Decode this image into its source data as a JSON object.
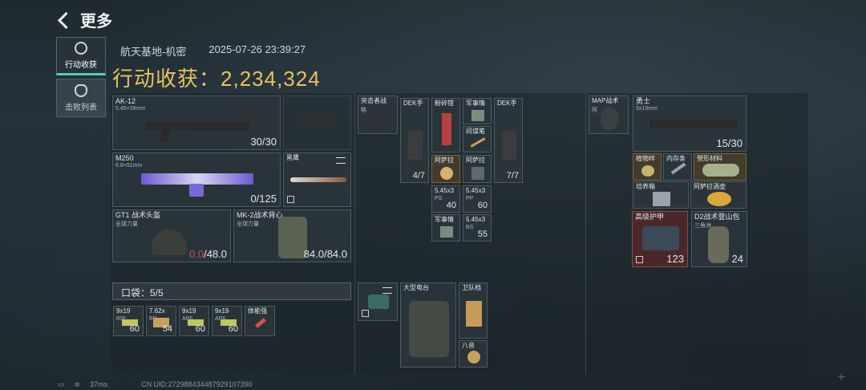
{
  "header": {
    "title": "更多"
  },
  "sidebar": [
    {
      "label": "行动收获",
      "icon": "loot-icon",
      "active": true
    },
    {
      "label": "击败列表",
      "icon": "skull-icon",
      "active": false
    }
  ],
  "match": {
    "map": "航天基地-机密",
    "time": "2025-07-26 23:39:27"
  },
  "gain": {
    "label": "行动收获：",
    "value": "2,234,324"
  },
  "loadout": {
    "primary": {
      "name": "AK-12",
      "caliber": "5.45×39mm",
      "ammo": "30/30"
    },
    "secondary": {
      "name": "M250",
      "caliber": "6.8×51mm",
      "ammo": "0/125"
    },
    "melee": {
      "name": "黑鹰"
    },
    "helmet": {
      "name": "GT1 战术头盔",
      "maker": "全球力量",
      "durability": "0.0",
      "max": "/48.0"
    },
    "armor": {
      "name": "MK-2战术背心",
      "maker": "全球力量",
      "durability": "84.0/84.0"
    }
  },
  "pocket": {
    "label": "口袋：5/5",
    "items": [
      {
        "name": "9x19",
        "sub": "RIP",
        "count": "60"
      },
      {
        "name": "7.62x",
        "sub": "BP",
        "count": "54"
      },
      {
        "name": "9x19",
        "sub": "AP6",
        "count": "60"
      },
      {
        "name": "9x19",
        "sub": "AP6",
        "count": "60"
      },
      {
        "name": "体能强",
        "sub": "",
        "count": ""
      }
    ]
  },
  "rig": {
    "items": [
      {
        "name": "突击者战",
        "sub": "略"
      },
      {
        "name": "DEK手",
        "count": "4/7"
      },
      {
        "name": "粉碎钳"
      },
      {
        "name": "军事情",
        "sub": ""
      },
      {
        "name": "间谍笔"
      },
      {
        "name": "DEK手",
        "count": "7/7"
      },
      {
        "name": "阿萨拉"
      },
      {
        "name": "阿萨拉"
      },
      {
        "name": "5.45x3",
        "sub": "PS",
        "count": "40"
      },
      {
        "name": "5.45x3",
        "sub": "PP",
        "count": "60"
      },
      {
        "name": "军事情",
        "sub": ""
      },
      {
        "name": "5.45x3",
        "sub": "BS",
        "count": "55"
      }
    ]
  },
  "backpack": {
    "items": [
      {
        "name": "大型电台"
      },
      {
        "name": "卫队档"
      },
      {
        "name": "八音"
      }
    ]
  },
  "container": {
    "items": [
      {
        "name": "MAP战术",
        "sub": "阿"
      },
      {
        "name": "勇士",
        "sub": "9x19mm",
        "count": "15/30"
      },
      {
        "name": "植物样"
      },
      {
        "name": "内存条"
      },
      {
        "name": "塑形材料"
      },
      {
        "name": "培养箱"
      },
      {
        "name": "阿萨拉酒壶"
      },
      {
        "name": "高级护甲",
        "count": "123"
      },
      {
        "name": "D2战术登山包",
        "sub": "三角洲",
        "count": "24"
      }
    ]
  },
  "status": {
    "ping": "37ms",
    "uid": "CN UID:272988434487929107390"
  },
  "colors": {
    "accent": "#4fd3b0",
    "gold": "#e8c35c",
    "damaged": "#d24b4b"
  }
}
